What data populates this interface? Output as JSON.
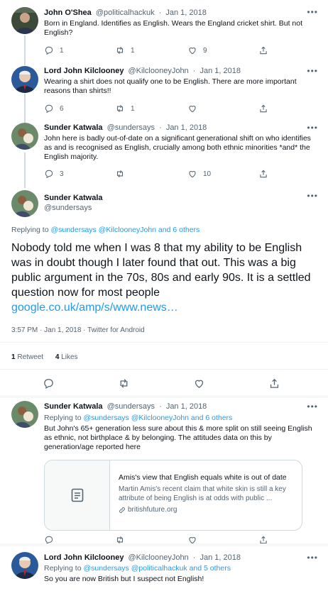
{
  "tweets": [
    {
      "name": "John O'Shea",
      "handle": "@politicalhackuk",
      "dot": "·",
      "date": "Jan 1, 2018",
      "text": "Born in England. Identifies as English. Wears the England cricket shirt. But not English?",
      "replies": "1",
      "retweets": "1",
      "likes": "9"
    },
    {
      "name": "Lord John Kilclooney",
      "handle": "@KilclooneyJohn",
      "dot": "·",
      "date": "Jan 1, 2018",
      "text": "Wearing a shirt does not qualify one to be English. There are more important reasons than shirts!!",
      "replies": "6",
      "retweets": "1",
      "likes": ""
    },
    {
      "name": "Sunder Katwala",
      "handle": "@sundersays",
      "dot": "·",
      "date": "Jan 1, 2018",
      "text": "John here is badly out-of-date on a significant generational shift on who identifies as and is recognised as English, crucially among both ethnic minorities *and* the English majority.",
      "replies": "3",
      "retweets": "",
      "likes": "10"
    }
  ],
  "focus": {
    "name": "Sunder Katwala",
    "handle": "@sundersays",
    "replying_prefix": "Replying to",
    "replying_mentions": "@sundersays @KilclooneyJohn and 6 others",
    "text": "Nobody told me when I was 8 that my ability to be English was in doubt though I later found that out. This was a big public argument in the 70s, 80s and early 90s. It is a settled question now for most people",
    "link": "google.co.uk/amp/s/www.news…",
    "timestamp": "3:57 PM · Jan 1, 2018 · Twitter for Android",
    "retweets_count": "1",
    "retweets_label": "Retweet",
    "likes_count": "4",
    "likes_label": "Likes"
  },
  "replies": [
    {
      "name": "Sunder Katwala",
      "handle": "@sundersays",
      "dot": "·",
      "date": "Jan 1, 2018",
      "replying_prefix": "Replying to",
      "replying_mentions": "@sundersays @KilclooneyJohn and 6 others",
      "text": "But John's 65+ generation less sure about this & more split on still seeing English as ethnic, not birthplace & by belonging. The attitudes data on this by generation/age reported here",
      "card": {
        "title": "Amis's view that English equals white is out of date",
        "description": "Martin Amis's recent claim that white skin is still a key attribute of being English is at odds with public ...",
        "domain": "britishfuture.org"
      }
    },
    {
      "name": "Lord John Kilclooney",
      "handle": "@KilclooneyJohn",
      "dot": "·",
      "date": "Jan 1, 2018",
      "replying_prefix": "Replying to",
      "replying_mentions": "@sundersays @politicalhackuk and 5 others",
      "text": "So you are now British but I suspect not English!"
    }
  ],
  "icons": {
    "reply": "reply-icon",
    "retweet": "retweet-icon",
    "like": "heart-icon",
    "share": "share-icon",
    "more": "more-icon",
    "article": "article-icon",
    "link": "link-icon"
  },
  "colors": {
    "accent": "#1d9bf0",
    "text": "#0f1419",
    "muted": "#536471",
    "border": "#eff3f4"
  }
}
